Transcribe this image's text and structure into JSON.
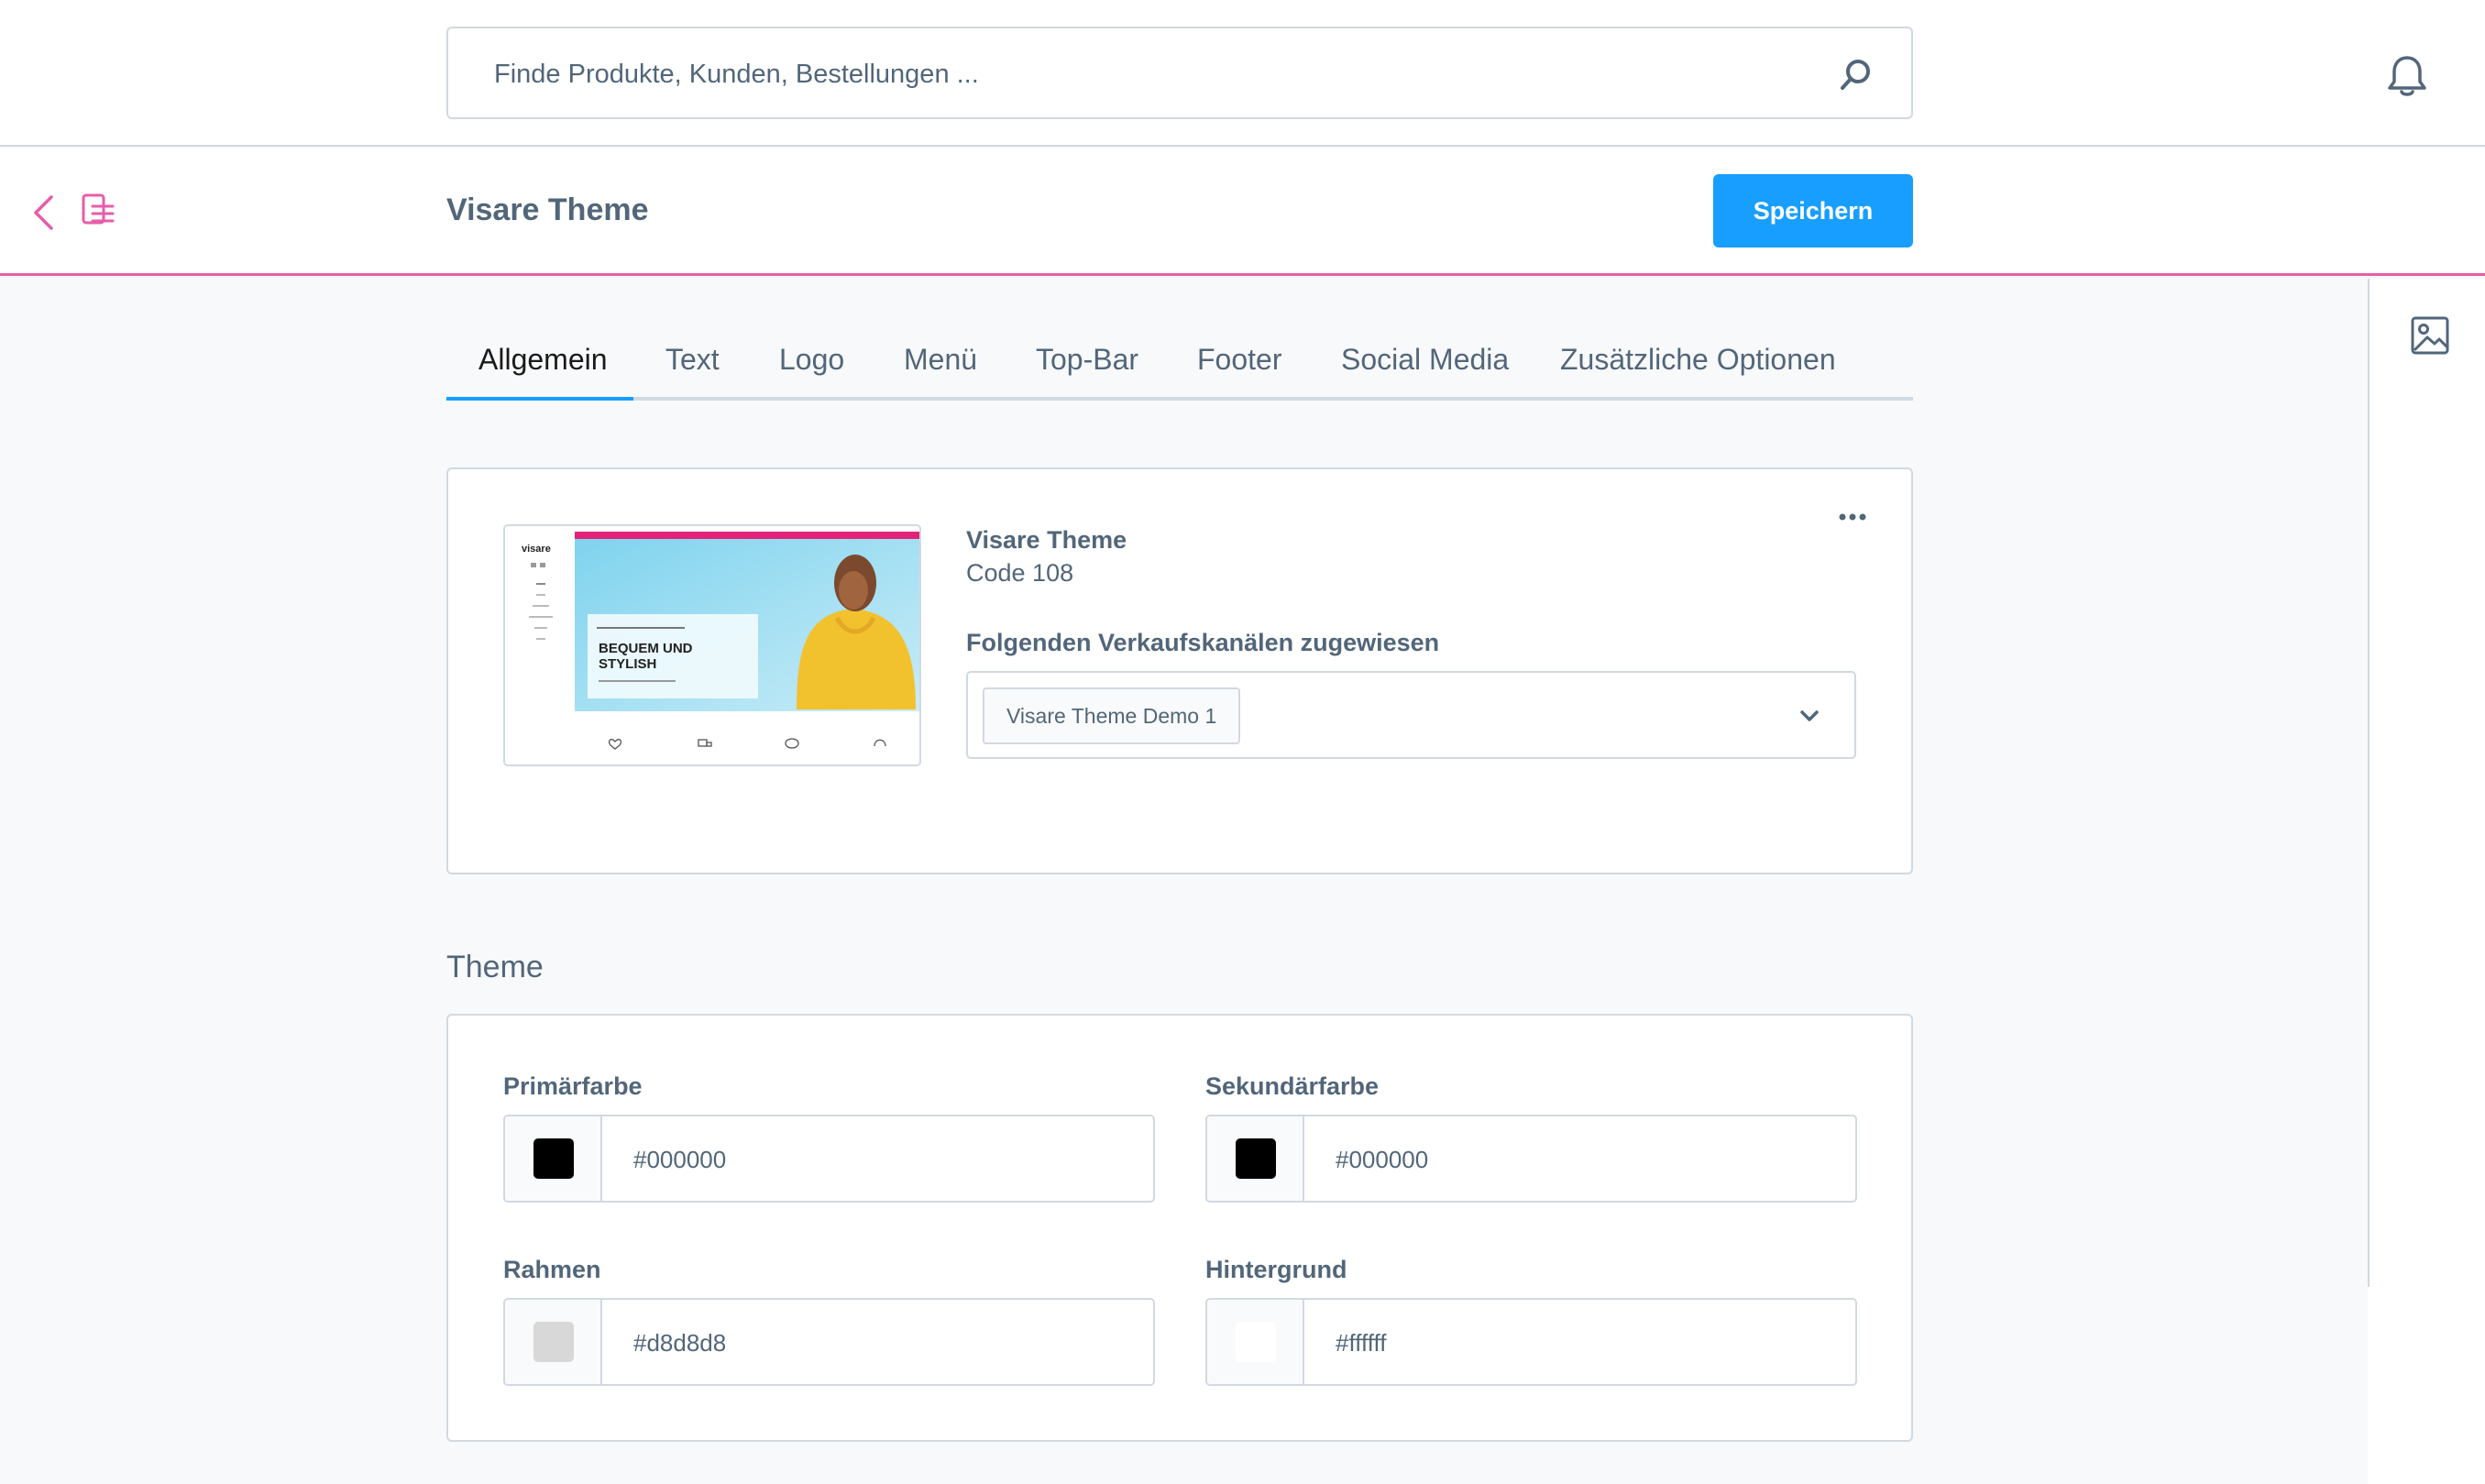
{
  "search": {
    "placeholder": "Finde Produkte, Kunden, Bestellungen ..."
  },
  "header": {
    "title": "Visare Theme",
    "save_label": "Speichern"
  },
  "tabs": [
    {
      "label": "Allgemein",
      "active": true
    },
    {
      "label": "Text"
    },
    {
      "label": "Logo"
    },
    {
      "label": "Menü"
    },
    {
      "label": "Top-Bar"
    },
    {
      "label": "Footer"
    },
    {
      "label": "Social Media"
    },
    {
      "label": "Zusätzliche Optionen"
    }
  ],
  "theme_info": {
    "name": "Visare Theme",
    "code": "Code 108",
    "sales_channels_label": "Folgenden Verkaufskanälen zugewiesen",
    "sales_channels": [
      "Visare Theme Demo 1"
    ],
    "preview": {
      "logo": "visare",
      "headline_line1": "BEQUEM UND",
      "headline_line2": "STYLISH"
    }
  },
  "theme_section": {
    "title": "Theme",
    "fields": [
      {
        "label": "Primärfarbe",
        "value": "#000000",
        "color": "#000000"
      },
      {
        "label": "Sekundärfarbe",
        "value": "#000000",
        "color": "#000000"
      },
      {
        "label": "Rahmen",
        "value": "#d8d8d8",
        "color": "#d8d8d8"
      },
      {
        "label": "Hintergrund",
        "value": "#ffffff",
        "color": "#ffffff"
      }
    ]
  },
  "colors": {
    "accent": "#189eff",
    "brand_line": "#e75da8",
    "border": "#d1d9e0",
    "text": "#52667a"
  },
  "icons": [
    "search-icon",
    "bell-icon",
    "back-icon",
    "list-icon",
    "media-icon",
    "more-icon",
    "chevron-down-icon"
  ]
}
